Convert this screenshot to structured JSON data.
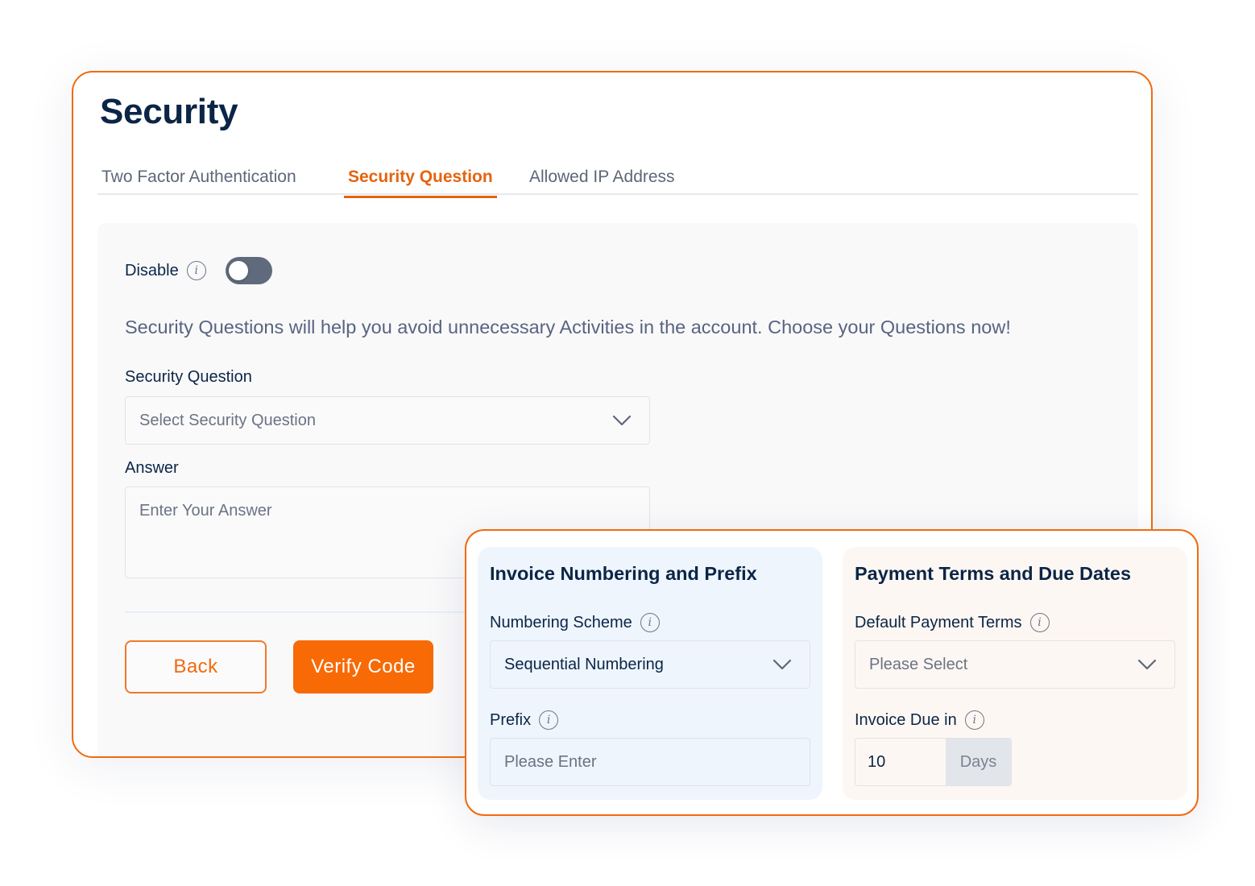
{
  "security": {
    "title": "Security",
    "tabs": [
      {
        "label": "Two Factor Authentication",
        "active": false
      },
      {
        "label": "Security Question",
        "active": true
      },
      {
        "label": "Allowed IP Address",
        "active": false
      }
    ],
    "toggle": {
      "label": "Disable",
      "state": "off"
    },
    "help_text": "Security Questions will help you avoid unnecessary Activities in the account. Choose your Questions now!",
    "question_field": {
      "label": "Security Question",
      "placeholder": "Select Security Question"
    },
    "answer_field": {
      "label": "Answer",
      "placeholder": "Enter Your Answer"
    },
    "buttons": {
      "back": "Back",
      "verify": "Verify Code"
    }
  },
  "invoice": {
    "numbering": {
      "title": "Invoice Numbering and Prefix",
      "scheme_label": "Numbering Scheme",
      "scheme_value": "Sequential Numbering",
      "prefix_label": "Prefix",
      "prefix_placeholder": "Please Enter"
    },
    "payment": {
      "title": "Payment Terms and Due Dates",
      "terms_label": "Default Payment Terms",
      "terms_placeholder": "Please Select",
      "due_label": "Invoice Due in",
      "due_value": "10",
      "due_unit": "Days"
    }
  },
  "colors": {
    "accent": "#f76a05",
    "heading": "#0b2546",
    "toggle_off": "#5f6b7c"
  },
  "icons": {
    "info": "i"
  }
}
